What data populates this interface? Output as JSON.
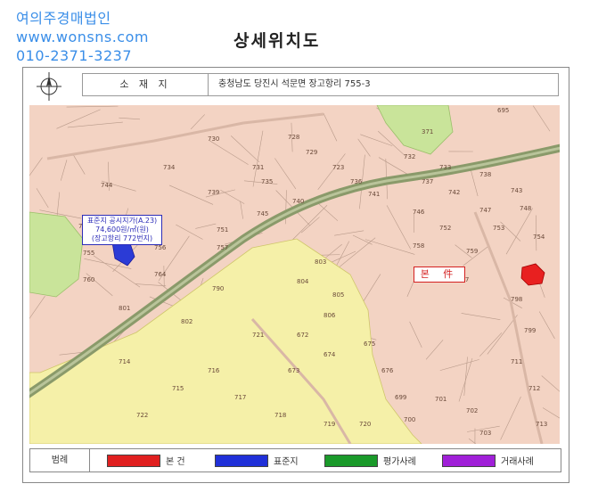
{
  "watermark": {
    "company": "여의주경매법인",
    "website": "www.wonsns.com",
    "phone": "010-2371-3237"
  },
  "title": "상세위치도",
  "address": {
    "label": "소 재 지",
    "value": "충청남도 당진시 석문면 장고항리 755-3"
  },
  "compass": {
    "north": "N",
    "south": "S"
  },
  "map": {
    "parcel_numbers": [
      "695",
      "730",
      "728",
      "371",
      "729",
      "731",
      "723",
      "732",
      "733",
      "734",
      "735",
      "736",
      "737",
      "738",
      "739",
      "740",
      "741",
      "742",
      "743",
      "744",
      "745",
      "746",
      "747",
      "748",
      "749",
      "750",
      "751",
      "752",
      "753",
      "754",
      "755",
      "756",
      "757",
      "758",
      "759",
      "760",
      "764",
      "790",
      "797",
      "798",
      "799",
      "801",
      "802",
      "803",
      "804",
      "805",
      "806",
      "672",
      "673",
      "674",
      "675",
      "676",
      "699",
      "700",
      "701",
      "702",
      "703",
      "711",
      "712",
      "713",
      "714",
      "715",
      "716",
      "717",
      "718",
      "719",
      "720",
      "721",
      "722"
    ],
    "standard_land_callout": [
      "표준지 공시지가(A.23)",
      "74,600원/㎡(원)",
      "(장고항리 772번지)"
    ],
    "subject_label": "본 件"
  },
  "legend": {
    "title": "범례",
    "items": [
      {
        "label": "본 건",
        "color": "#e02020"
      },
      {
        "label": "표준지",
        "color": "#2030d8"
      },
      {
        "label": "평가사례",
        "color": "#1a9a2a"
      },
      {
        "label": "거래사례",
        "color": "#a020d8"
      }
    ]
  }
}
